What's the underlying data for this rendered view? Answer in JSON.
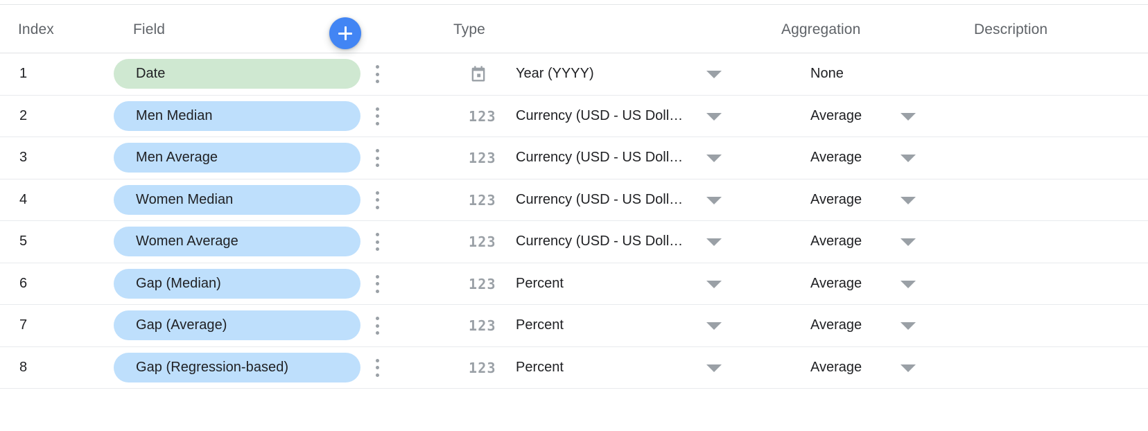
{
  "header": {
    "index_label": "Index",
    "field_label": "Field",
    "type_label": "Type",
    "aggregation_label": "Aggregation",
    "description_label": "Description",
    "add_field_icon": "plus-icon"
  },
  "colors": {
    "accent": "#4285f4",
    "dimension_chip": "#cfe8d1",
    "metric_chip": "#bedffc",
    "header_text": "#5f6368",
    "body_text": "#202124",
    "icon_gray": "#9aa0a6",
    "row_divider": "#e8eaed"
  },
  "rows": [
    {
      "index": "1",
      "field": "Date",
      "chip_kind": "dimension",
      "type_icon": "calendar-icon",
      "type": "Year (YYYY)",
      "has_type_caret": true,
      "aggregation": "None",
      "has_agg_caret": false,
      "description": "",
      "menu_icon": "more-vert-icon"
    },
    {
      "index": "2",
      "field": "Men Median",
      "chip_kind": "metric",
      "type_icon": "numeric-123-icon",
      "type": "Currency (USD - US Doll…",
      "has_type_caret": true,
      "aggregation": "Average",
      "has_agg_caret": true,
      "description": "",
      "menu_icon": "more-vert-icon"
    },
    {
      "index": "3",
      "field": "Men Average",
      "chip_kind": "metric",
      "type_icon": "numeric-123-icon",
      "type": "Currency (USD - US Doll…",
      "has_type_caret": true,
      "aggregation": "Average",
      "has_agg_caret": true,
      "description": "",
      "menu_icon": "more-vert-icon"
    },
    {
      "index": "4",
      "field": "Women Median",
      "chip_kind": "metric",
      "type_icon": "numeric-123-icon",
      "type": "Currency (USD - US Doll…",
      "has_type_caret": true,
      "aggregation": "Average",
      "has_agg_caret": true,
      "description": "",
      "menu_icon": "more-vert-icon"
    },
    {
      "index": "5",
      "field": "Women Average",
      "chip_kind": "metric",
      "type_icon": "numeric-123-icon",
      "type": "Currency (USD - US Doll…",
      "has_type_caret": true,
      "aggregation": "Average",
      "has_agg_caret": true,
      "description": "",
      "menu_icon": "more-vert-icon"
    },
    {
      "index": "6",
      "field": "Gap (Median)",
      "chip_kind": "metric",
      "type_icon": "numeric-123-icon",
      "type": "Percent",
      "has_type_caret": true,
      "aggregation": "Average",
      "has_agg_caret": true,
      "description": "",
      "menu_icon": "more-vert-icon"
    },
    {
      "index": "7",
      "field": "Gap (Average)",
      "chip_kind": "metric",
      "type_icon": "numeric-123-icon",
      "type": "Percent",
      "has_type_caret": true,
      "aggregation": "Average",
      "has_agg_caret": true,
      "description": "",
      "menu_icon": "more-vert-icon"
    },
    {
      "index": "8",
      "field": "Gap (Regression-based)",
      "chip_kind": "metric",
      "type_icon": "numeric-123-icon",
      "type": "Percent",
      "has_type_caret": true,
      "aggregation": "Average",
      "has_agg_caret": true,
      "description": "",
      "menu_icon": "more-vert-icon"
    }
  ],
  "numeric_icon_text": "123"
}
